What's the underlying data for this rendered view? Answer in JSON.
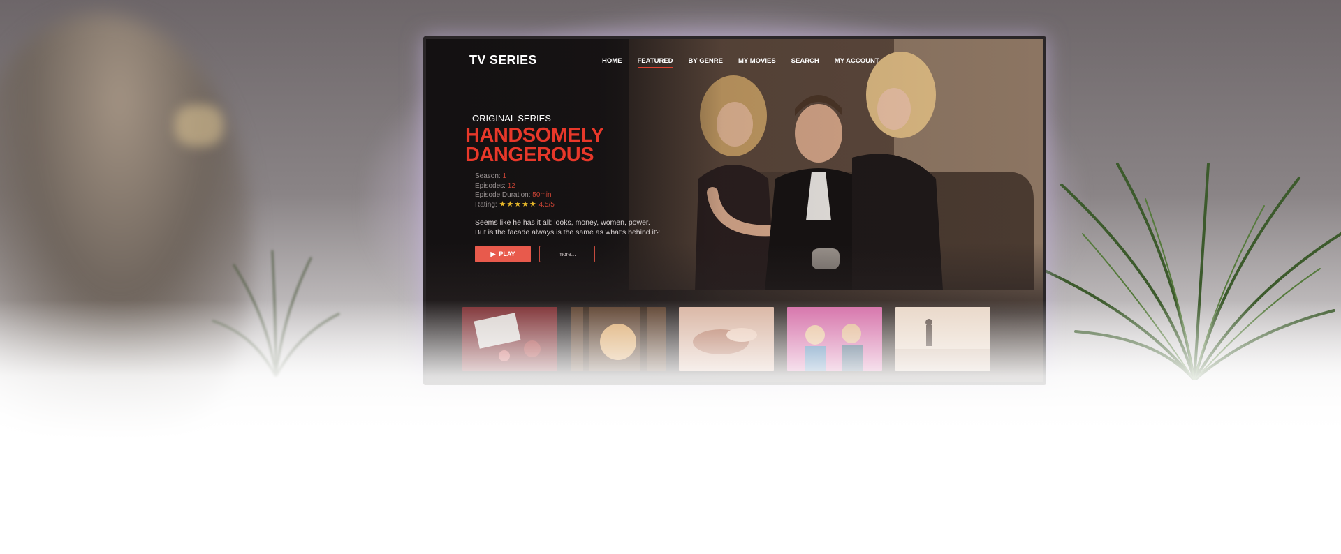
{
  "brand": "TV SERIES",
  "nav": {
    "items": [
      {
        "label": "HOME",
        "active": false
      },
      {
        "label": "FEATURED",
        "active": true
      },
      {
        "label": "BY GENRE",
        "active": false
      },
      {
        "label": "MY MOVIES",
        "active": false
      },
      {
        "label": "SEARCH",
        "active": false
      },
      {
        "label": "MY ACCOUNT",
        "active": false
      }
    ]
  },
  "hero": {
    "eyebrow": "ORIGINAL SERIES",
    "title_line1": "HANDSOMELY",
    "title_line2": "DANGEROUS",
    "season_label": "Season:",
    "season_value": "1",
    "episodes_label": "Episodes:",
    "episodes_value": "12",
    "duration_label": "Episode Duration:",
    "duration_value": "50min",
    "rating_label": "Rating:",
    "rating_stars": "★★★★★",
    "rating_value": "4.5/5",
    "description_line1": "Seems like he has it all: looks, money, women, power.",
    "description_line2": "But is the facade always is the same as what's behind it?",
    "play_label": "PLAY",
    "more_label": "more..."
  },
  "thumbnails": [
    {
      "name": "thumb-red-desk",
      "icon": "photo-icon"
    },
    {
      "name": "thumb-sunset-trees",
      "icon": "photo-icon"
    },
    {
      "name": "thumb-hands",
      "icon": "photo-icon"
    },
    {
      "name": "thumb-group-selfie",
      "icon": "photo-icon"
    },
    {
      "name": "thumb-figure-beach",
      "icon": "photo-icon"
    }
  ],
  "colors": {
    "accent": "#e8382a",
    "star": "#e8b92a",
    "screen_bg": "#1b1718"
  },
  "icons": {
    "play": "play-icon"
  }
}
